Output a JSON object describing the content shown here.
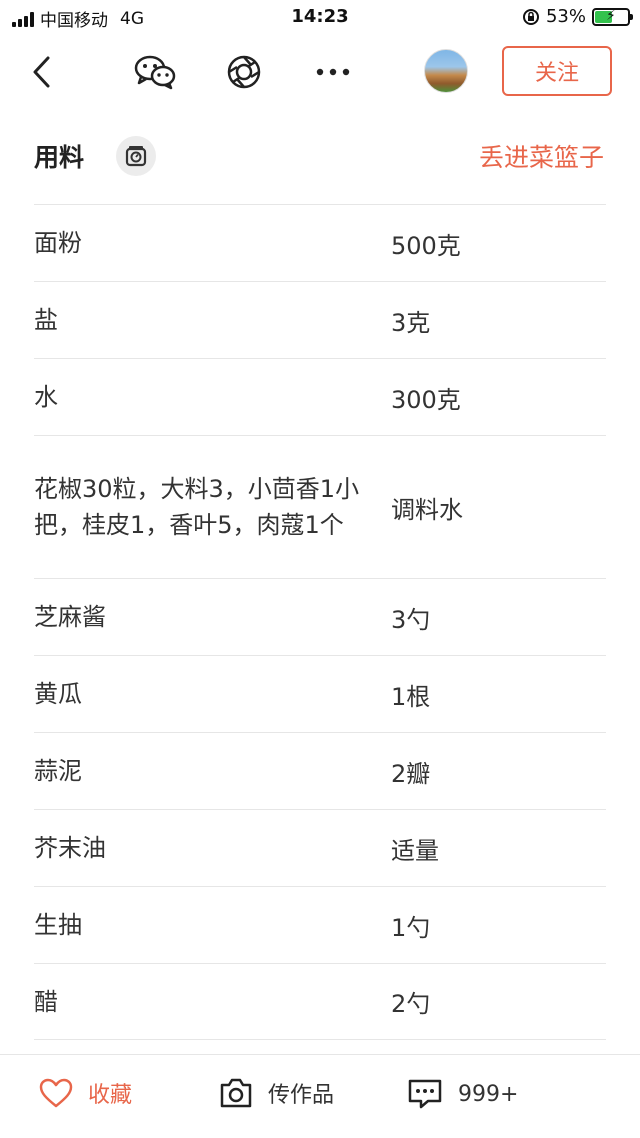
{
  "status_bar": {
    "carrier": "中国移动",
    "network": "4G",
    "time": "14:23",
    "battery_percent": "53%",
    "battery_level": 0.53
  },
  "nav": {
    "back_icon": "chevron-left-icon",
    "icons": [
      "wechat-icon",
      "moments-icon",
      "more-icon"
    ],
    "follow_label": "关注"
  },
  "ingredients": {
    "title": "用料",
    "basket_label": "丢进菜篮子",
    "rows": [
      {
        "name": "面粉",
        "qty": "500克"
      },
      {
        "name": "盐",
        "qty": "3克"
      },
      {
        "name": "水",
        "qty": "300克"
      },
      {
        "name": "花椒30粒，大料3，小茴香1小把，桂皮1，香叶5，肉蔻1个",
        "qty": "调料水"
      },
      {
        "name": "芝麻酱",
        "qty": "3勺"
      },
      {
        "name": "黄瓜",
        "qty": "1根"
      },
      {
        "name": "蒜泥",
        "qty": "2瓣"
      },
      {
        "name": "芥末油",
        "qty": "适量"
      },
      {
        "name": "生抽",
        "qty": "1勺"
      },
      {
        "name": "醋",
        "qty": "2勺"
      }
    ]
  },
  "bottom_bar": {
    "favorite_label": "收藏",
    "upload_label": "传作品",
    "comments_count": "999+"
  },
  "colors": {
    "accent": "#e8664a",
    "divider": "#e6e6e6",
    "text": "#333333"
  }
}
